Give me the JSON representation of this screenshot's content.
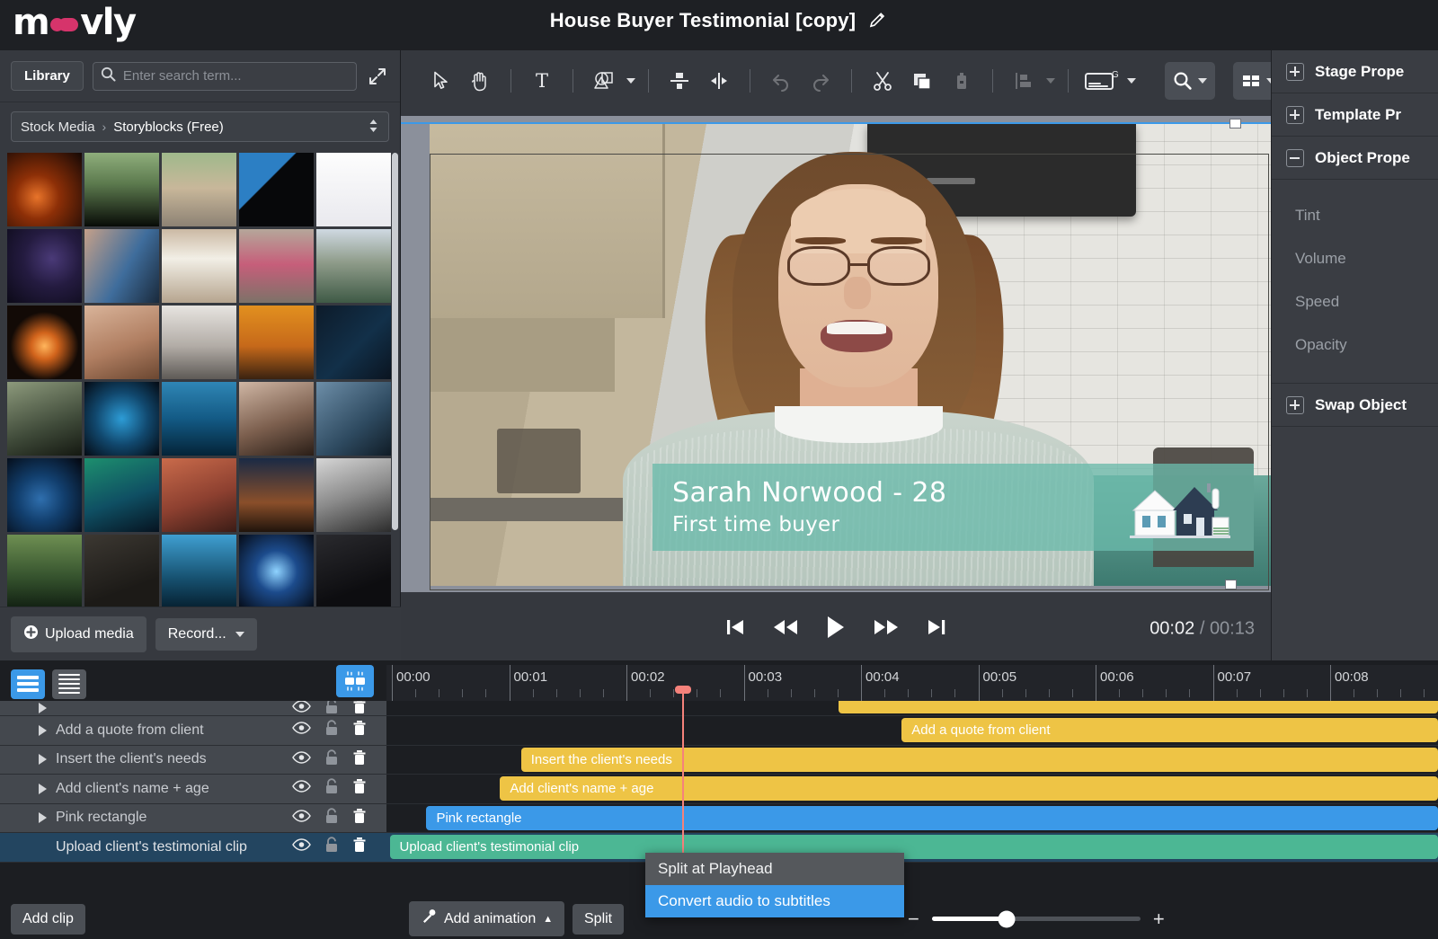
{
  "app": {
    "brand": "moovly",
    "project_title": "House Buyer Testimonial [copy]",
    "edit_icon": "pencil-icon"
  },
  "library": {
    "library_button": "Library",
    "search_placeholder": "Enter search term...",
    "search_value": "",
    "expand_icon": "expand-diagonal-icon",
    "breadcrumb_root": "Stock Media",
    "breadcrumb_sep": "›",
    "breadcrumb_current": "Storyblocks (Free)",
    "breadcrumb_caret": "⌃⌄",
    "upload_label": "Upload media",
    "record_label": "Record...",
    "thumbnails": [
      {
        "name": "fire-embers",
        "css": "radial-gradient(circle at 40% 60%, #e8742a 0%, #8d2f07 35%, #140805 100%)"
      },
      {
        "name": "falling-money",
        "css": "linear-gradient(180deg,#8fae7c 0%, #5c7a4e 42%, #080b07 100%)"
      },
      {
        "name": "runner-legs",
        "css": "linear-gradient(180deg,#9fb98b 0%, #c8b79a 48%, #8d8274 100%)"
      },
      {
        "name": "silhouette-person",
        "css": "linear-gradient(135deg,#2c7fc4 0%, #2c7fc4 38%, #07080a 39%, #07080a 100%)"
      },
      {
        "name": "browser-screenshot",
        "css": "linear-gradient(180deg,#fdfdfd 0%, #e9e9ee 100%)"
      },
      {
        "name": "starry-sky",
        "css": "radial-gradient(circle at 60% 40%, #4a3a78 0%, #241b40 45%, #0c0a18 100%)"
      },
      {
        "name": "glasses-screen-reflection",
        "css": "linear-gradient(120deg,#c5a089 0%, #3f6d9c 55%, #1a2a3c 100%)"
      },
      {
        "name": "closed-sign",
        "css": "linear-gradient(180deg,#cbb9a4 0%, #f2efe6 40%, #b6a58f 100%)"
      },
      {
        "name": "masked-woman-crowd",
        "css": "linear-gradient(180deg,#b5a79a 0%, #c65e7a 48%, #7d7268 100%)"
      },
      {
        "name": "city-aerial",
        "css": "linear-gradient(180deg,#cfd9e2 0%, #8f9c8a 45%, #3f5a46 100%)"
      },
      {
        "name": "explosion-dark",
        "css": "radial-gradient(circle at 50% 55%, #ffb55c 0%, #d2641c 24%, #120a06 62%)"
      },
      {
        "name": "closed-eye",
        "css": "linear-gradient(160deg,#d9b49a 0%, #b07e61 55%, #6b4731 100%)"
      },
      {
        "name": "hands-keyboard",
        "css": "linear-gradient(180deg,#e7e4e0 0%, #b2aca6 55%, #5e5a56 100%)"
      },
      {
        "name": "orange-sunset",
        "css": "linear-gradient(180deg,#e2901f 0%, #c6691a 55%, #3a2210 100%)"
      },
      {
        "name": "code-on-screen",
        "css": "linear-gradient(135deg,#0d1b2a 0%, #123049 55%, #0a1420 100%)"
      },
      {
        "name": "dollar-bill-macro",
        "css": "linear-gradient(160deg,#8d9a7c 0%, #3f4a39 60%, #141811 100%)"
      },
      {
        "name": "globe-network",
        "css": "radial-gradient(circle at 50% 50%, #2d9cd6 0%, #11486e 50%, #040a12 100%)"
      },
      {
        "name": "underwater-light",
        "css": "linear-gradient(180deg,#2f86b5 0%, #135a85 50%, #042438 100%)"
      },
      {
        "name": "phone-in-hand",
        "css": "linear-gradient(160deg,#cfb6a4 0%, #7c5f4e 55%, #2a1e17 100%)"
      },
      {
        "name": "glasses-on-laptop",
        "css": "linear-gradient(140deg,#6d8ea8 0%, #2e4a60 60%, #101c26 100%)"
      },
      {
        "name": "earth-from-space",
        "css": "radial-gradient(circle at 45% 55%, #2f6fae 0%, #123f6e 40%, #03060d 100%)"
      },
      {
        "name": "digital-tablet-glow",
        "css": "linear-gradient(160deg,#1d8f6e 0%, #0f4f63 55%, #061320 100%)"
      },
      {
        "name": "stressed-man",
        "css": "linear-gradient(160deg,#c96b4b 0%, #8d4030 55%, #3b1c16 100%)"
      },
      {
        "name": "city-lights-night",
        "css": "linear-gradient(180deg,#1a2a45 0%, #8a4f2a 60%, #20140c 100%)"
      },
      {
        "name": "crowd-bw",
        "css": "linear-gradient(160deg,#d6d6d6 0%, #8a8a8a 50%, #2c2c2c 100%)"
      },
      {
        "name": "forest-aerial",
        "css": "linear-gradient(180deg,#6e8f52 0%, #33502c 60%, #122012 100%)"
      },
      {
        "name": "dark-texture",
        "css": "linear-gradient(160deg,#3c3832 0%, #1c1a17 70%)"
      },
      {
        "name": "blue-waves",
        "css": "linear-gradient(180deg,#3f9fd1 0%, #16506f 60%, #062030 100%)"
      },
      {
        "name": "fireworks-blue",
        "css": "radial-gradient(circle at 50% 50%, #8fd3ff 0%, #1c4b8c 40%, #050b16 100%)"
      },
      {
        "name": "dark-abstract",
        "css": "linear-gradient(160deg,#2a2a2e 0%, #0d0d10 70%)"
      }
    ]
  },
  "toolbar": {
    "items": [
      {
        "name": "select-cursor-tool",
        "icon": "cursor-icon"
      },
      {
        "name": "pan-hand-tool",
        "icon": "hand-icon"
      },
      {
        "name": "text-tool",
        "icon": "text-t-icon"
      },
      {
        "name": "shapes-tool",
        "icon": "shapes-icon"
      },
      {
        "name": "align-vertical-tool",
        "icon": "align-vertical-icon"
      },
      {
        "name": "align-horizontal-tool",
        "icon": "align-horizontal-icon"
      },
      {
        "name": "undo-button",
        "icon": "undo-arrow-icon"
      },
      {
        "name": "redo-button",
        "icon": "redo-arrow-icon"
      },
      {
        "name": "cut-button",
        "icon": "scissors-icon"
      },
      {
        "name": "copy-button",
        "icon": "copy-icon"
      },
      {
        "name": "paste-button",
        "icon": "glue-icon"
      },
      {
        "name": "arrange-button",
        "icon": "arrange-icon"
      },
      {
        "name": "subtitles-button",
        "icon": "subtitle-g-icon"
      },
      {
        "name": "zoom-button",
        "icon": "magnifier-icon"
      },
      {
        "name": "layout-button",
        "icon": "grid-icon"
      }
    ]
  },
  "stage": {
    "lower_third": {
      "name_text": "Sarah Norwood - 28",
      "subtitle_text": "First time buyer",
      "house_icon": "house-icon",
      "bg_color": "#6abaaa"
    }
  },
  "playback": {
    "skip_back": "skip-to-start-icon",
    "rewind": "rewind-icon",
    "play": "play-icon",
    "forward": "fast-forward-icon",
    "skip_end": "skip-to-end-icon",
    "current_time": "00:02",
    "separator": "/",
    "total_time": "00:13"
  },
  "properties": {
    "sections": [
      {
        "name": "stage-properties",
        "label": "Stage Prope",
        "state": "collapsed"
      },
      {
        "name": "template-properties",
        "label": "Template Pr",
        "state": "collapsed"
      },
      {
        "name": "object-properties",
        "label": "Object Prope",
        "state": "expanded"
      }
    ],
    "object_rows": [
      "Tint",
      "Volume",
      "Speed",
      "Opacity"
    ],
    "swap_section": {
      "name": "swap-object",
      "label": "Swap Object",
      "state": "collapsed"
    }
  },
  "timeline": {
    "view_toggle_list": "list-view-icon",
    "view_toggle_compact": "compact-view-icon",
    "clip_view_button": "clip-view-icon",
    "ruler_labels": [
      "00:00",
      "00:01",
      "00:02",
      "00:03",
      "00:04",
      "00:05",
      "00:06",
      "00:07",
      "00:08"
    ],
    "playhead_time": "00:02",
    "track_icons": {
      "eye": "eye-icon",
      "lock": "lock-icon",
      "trash": "trash-icon"
    },
    "tracks": [
      {
        "name": "partial-top-track",
        "label": "",
        "clip_label": "",
        "color": "yellow",
        "start_pct": 43.0,
        "width_pct": 57,
        "has_arrow": true,
        "selected": false,
        "partial": true
      },
      {
        "name": "track-add-a-quote",
        "label": "Add a quote from client",
        "clip_label": "Add a quote from client",
        "color": "yellow",
        "start_pct": 49.0,
        "width_pct": 51,
        "has_arrow": true,
        "selected": false
      },
      {
        "name": "track-insert-needs",
        "label": "Insert the client's needs",
        "clip_label": "Insert the client's needs",
        "color": "yellow",
        "start_pct": 12.8,
        "width_pct": 87.2,
        "has_arrow": true,
        "selected": false
      },
      {
        "name": "track-client-name-age",
        "label": "Add client's name + age",
        "clip_label": "Add client's name + age",
        "color": "yellow",
        "start_pct": 10.8,
        "width_pct": 89.2,
        "has_arrow": true,
        "selected": false
      },
      {
        "name": "track-pink-rectangle",
        "label": "Pink rectangle",
        "clip_label": "Pink rectangle",
        "color": "blue",
        "start_pct": 3.8,
        "width_pct": 96.2,
        "has_arrow": true,
        "selected": false
      },
      {
        "name": "track-testimonial-clip",
        "label": "Upload client's testimonial clip",
        "clip_label": "Upload client's testimonial clip",
        "color": "green",
        "start_pct": 0.3,
        "width_pct": 99.7,
        "has_arrow": false,
        "selected": true
      }
    ]
  },
  "context_menu": {
    "items": [
      {
        "name": "split-at-playhead-item",
        "label": "Split at Playhead",
        "highlighted": false
      },
      {
        "name": "convert-audio-to-subtitles-item",
        "label": "Convert audio to subtitles",
        "highlighted": true
      }
    ]
  },
  "bottom_bar": {
    "add_clip_label": "Add clip",
    "add_animation_label": "Add animation",
    "add_animation_caret": "▲",
    "animation_icon": "magic-wand-icon",
    "split_label": "Split",
    "zoom_minus": "−",
    "zoom_plus": "+",
    "zoom_percent": 36
  },
  "colors": {
    "accent_blue": "#3b99e8",
    "clip_yellow": "#eec445",
    "clip_green": "#4cb794",
    "playhead_red": "#f5827b",
    "brand_pink": "#d6346b"
  }
}
